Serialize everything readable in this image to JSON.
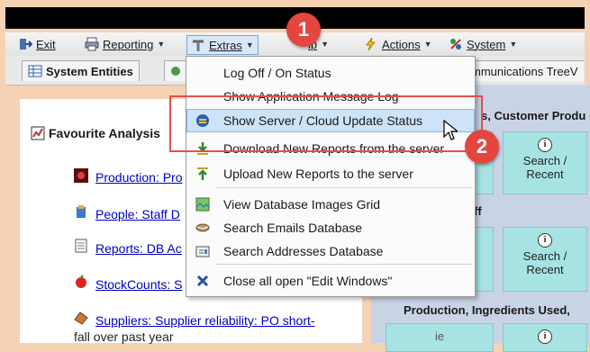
{
  "menubar": {
    "exit": "Exit",
    "reporting": "Reporting",
    "extras": "Extras",
    "help": "lp",
    "actions": "Actions",
    "system": "System"
  },
  "tabs": {
    "system_entities": "System Entities",
    "communications": "mmunications TreeV"
  },
  "favourites": {
    "title": "Favourite Analysis",
    "items": [
      "Production: Pro",
      "People: Staff D",
      "Reports: DB Ac",
      "StockCounts: S",
      "Suppliers: Supplier reliability: PO short-",
      "fall over past year"
    ]
  },
  "right_panel": {
    "section1": "s, Customer Produ",
    "section2": "ff",
    "section3": "Production,  Ingredients Used,",
    "tile_label_1": "Search /",
    "tile_label_2": "Recent",
    "tile_partial": "ie"
  },
  "dropdown": {
    "items": [
      {
        "label": "Log Off / On Status",
        "icon": "none"
      },
      {
        "label": "Show Application Message Log",
        "icon": "none"
      },
      {
        "label": "Show Server / Cloud Update Status",
        "icon": "cloud-update-icon"
      },
      {
        "label": "Download New Reports from the server",
        "icon": "download-icon"
      },
      {
        "label": "Upload New Reports to the server",
        "icon": "upload-icon"
      },
      {
        "label": "View Database Images Grid",
        "icon": "images-grid-icon"
      },
      {
        "label": "Search Emails Database",
        "icon": "emails-icon"
      },
      {
        "label": "Search Addresses Database",
        "icon": "addresses-icon"
      },
      {
        "label": "Close all open \"Edit Windows\"",
        "icon": "close-icon"
      }
    ]
  },
  "callouts": {
    "step1": "1",
    "step2": "2"
  },
  "colors": {
    "background": "#f6d2b4",
    "badge": "#e4463f",
    "highlight": "#cde3f7",
    "tile": "#a7e3e3"
  }
}
